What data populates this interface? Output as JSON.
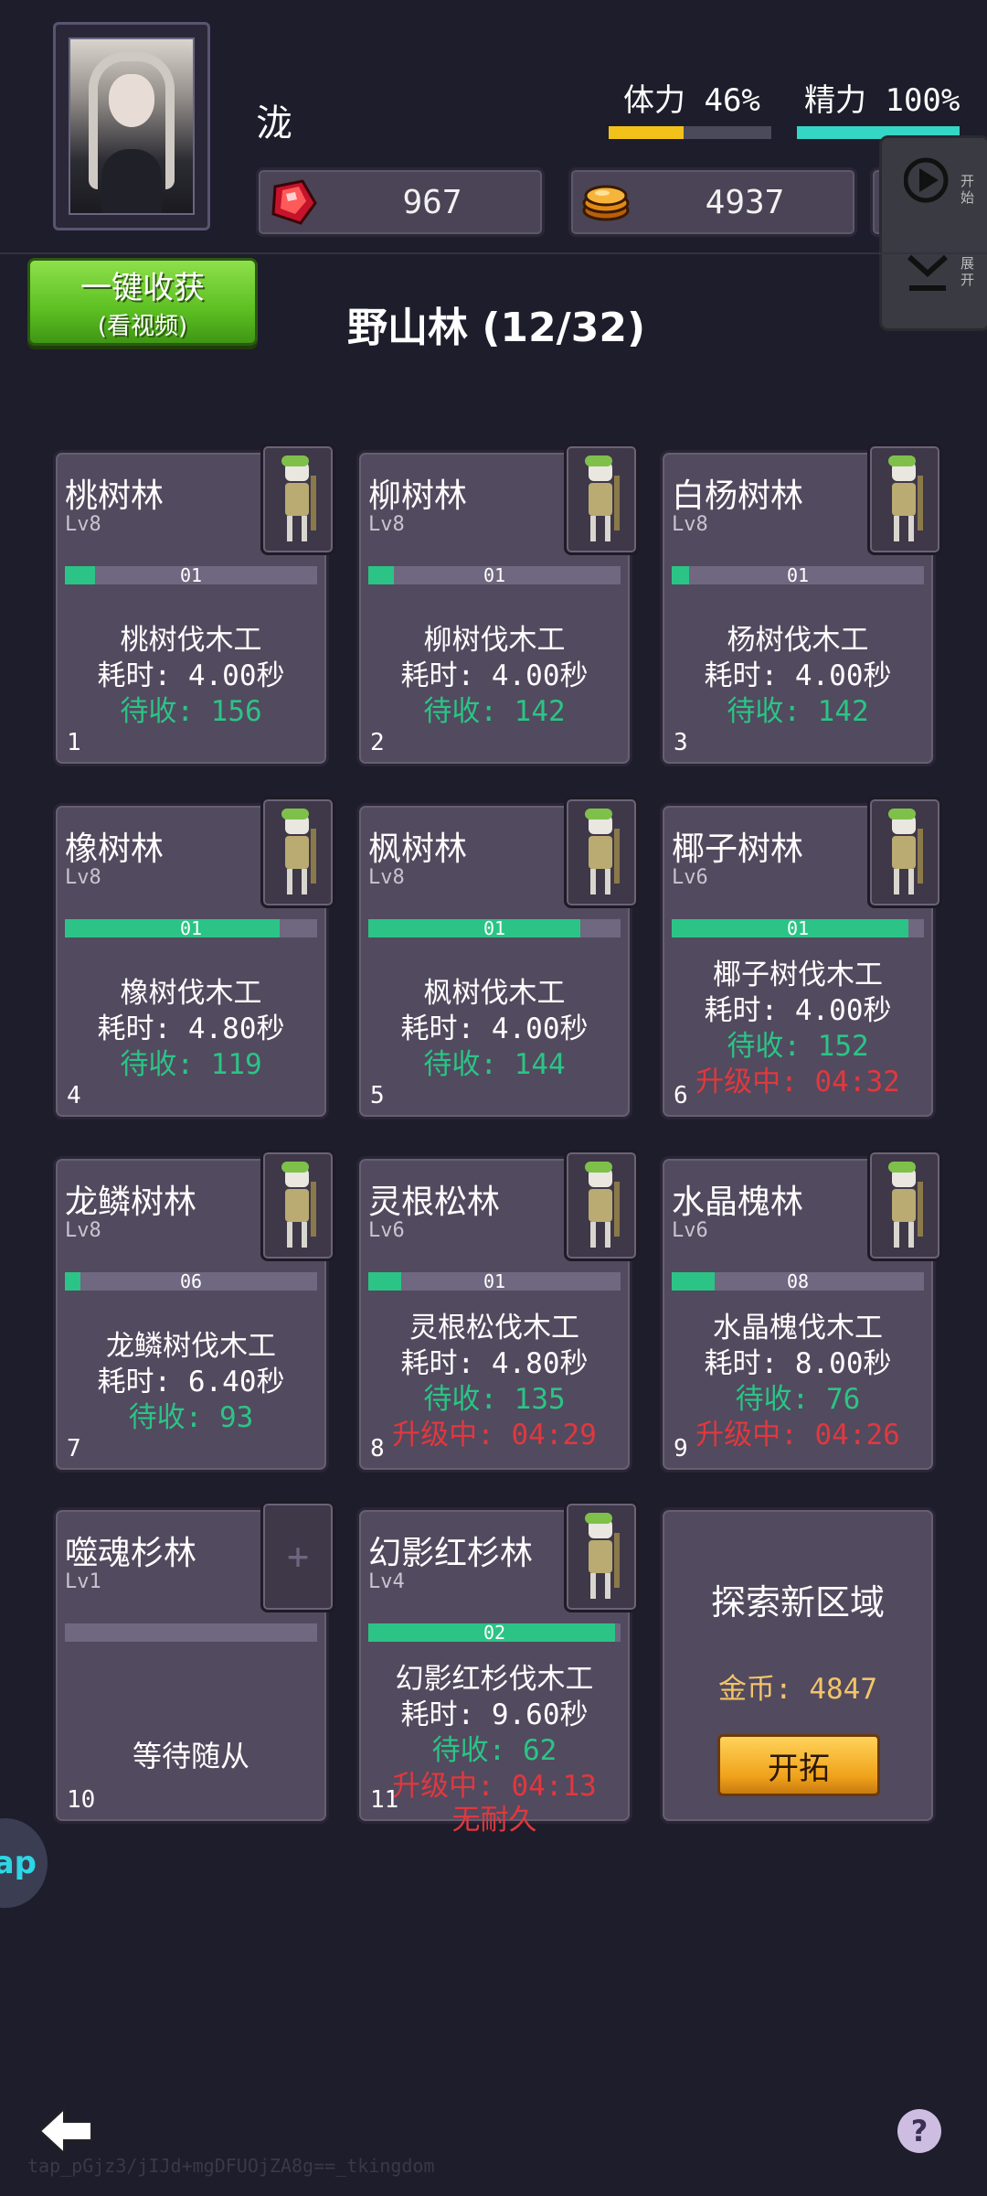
{
  "player": {
    "name": "泷"
  },
  "stats": {
    "stamina_label": "体力 46%",
    "stamina_fraction": 0.46,
    "stamina_color": "#f3c21a",
    "energy_label": "精力 100%",
    "energy_fraction": 1.0,
    "energy_color": "#34d6c6"
  },
  "currency": {
    "gems": "967",
    "gems_icon": "red-gem-icon",
    "coins": "4937",
    "coins_icon": "gold-coin-stack-icon"
  },
  "side_panel": {
    "start_label": "开始",
    "expand_label": "展开"
  },
  "harvest_button": {
    "main": "一键收获",
    "sub": "(看视频)"
  },
  "region_title": "野山林 (12/32)",
  "cards": [
    {
      "name": "桃树林",
      "lv": "Lv8",
      "progress_label": "01",
      "progress": 0.12,
      "job": "桃树伐木工",
      "time": "耗时: 4.00秒",
      "pending": "待收: 156",
      "index": "1"
    },
    {
      "name": "柳树林",
      "lv": "Lv8",
      "progress_label": "01",
      "progress": 0.1,
      "job": "柳树伐木工",
      "time": "耗时: 4.00秒",
      "pending": "待收: 142",
      "index": "2"
    },
    {
      "name": "白杨树林",
      "lv": "Lv8",
      "progress_label": "01",
      "progress": 0.07,
      "job": "杨树伐木工",
      "time": "耗时: 4.00秒",
      "pending": "待收: 142",
      "index": "3"
    },
    {
      "name": "橡树林",
      "lv": "Lv8",
      "progress_label": "01",
      "progress": 0.85,
      "job": "橡树伐木工",
      "time": "耗时: 4.80秒",
      "pending": "待收: 119",
      "index": "4"
    },
    {
      "name": "枫树林",
      "lv": "Lv8",
      "progress_label": "01",
      "progress": 0.84,
      "job": "枫树伐木工",
      "time": "耗时: 4.00秒",
      "pending": "待收: 144",
      "index": "5"
    },
    {
      "name": "椰子树林",
      "lv": "Lv6",
      "progress_label": "01",
      "progress": 0.94,
      "job": "椰子树伐木工",
      "time": "耗时: 4.00秒",
      "pending": "待收: 152",
      "upgrade": "升级中: 04:32",
      "index": "6"
    },
    {
      "name": "龙鳞树林",
      "lv": "Lv8",
      "progress_label": "06",
      "progress": 0.06,
      "job": "龙鳞树伐木工",
      "time": "耗时: 6.40秒",
      "pending": "待收: 93",
      "index": "7"
    },
    {
      "name": "灵根松林",
      "lv": "Lv6",
      "progress_label": "01",
      "progress": 0.13,
      "job": "灵根松伐木工",
      "time": "耗时: 4.80秒",
      "pending": "待收: 135",
      "upgrade": "升级中: 04:29",
      "index": "8"
    },
    {
      "name": "水晶槐林",
      "lv": "Lv6",
      "progress_label": "08",
      "progress": 0.17,
      "job": "水晶槐伐木工",
      "time": "耗时: 8.00秒",
      "pending": "待收: 76",
      "upgrade": "升级中: 04:26",
      "index": "9"
    },
    {
      "name": "噬魂杉林",
      "lv": "Lv1",
      "progress_label": "",
      "progress": 0.0,
      "waiting": "等待随从",
      "index": "10"
    },
    {
      "name": "幻影红杉林",
      "lv": "Lv4",
      "progress_label": "02",
      "progress": 0.98,
      "job": "幻影红杉伐木工",
      "time": "耗时: 9.60秒",
      "pending": "待收: 62",
      "upgrade": "升级中: 04:13",
      "nodurability": "无耐久",
      "index": "11"
    }
  ],
  "explore": {
    "title": "探索新区域",
    "cost": "金币: 4847",
    "button": "开拓"
  },
  "edge_bubble": "ap",
  "help": "?",
  "footer_id": "tap_pGjz3/jIJd+mgDFUOjZA8g==_tkingdom",
  "colors": {
    "background": "#1e1d2b",
    "card": "#524a5e",
    "progress": "#2bc486",
    "pending": "#2bc486",
    "upgrade": "#e0383e"
  }
}
